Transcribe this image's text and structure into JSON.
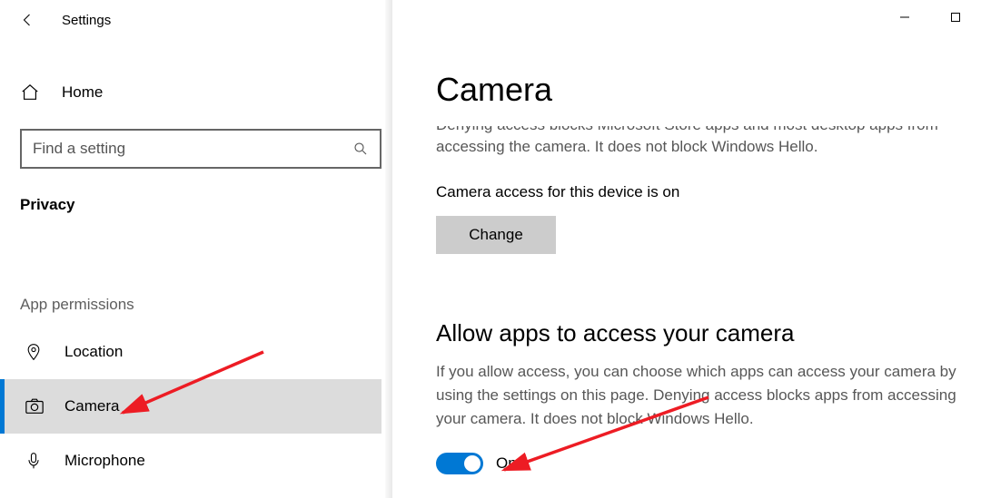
{
  "window": {
    "title": "Settings"
  },
  "sidebar": {
    "home_label": "Home",
    "search_placeholder": "Find a setting",
    "category_heading": "Privacy",
    "group_label": "App permissions",
    "items": [
      {
        "label": "Location"
      },
      {
        "label": "Camera"
      },
      {
        "label": "Microphone"
      }
    ]
  },
  "main": {
    "page_title": "Camera",
    "partial_denying_text": "Denying access blocks Microsoft Store apps and most desktop apps from accessing the camera. It does not block Windows Hello.",
    "device_access_status": "Camera access for this device is on",
    "change_button": "Change",
    "allow_heading": "Allow apps to access your camera",
    "allow_desc": "If you allow access, you can choose which apps can access your camera by using the settings on this page. Denying access blocks apps from accessing your camera. It does not block Windows Hello.",
    "toggle_state_label": "On"
  }
}
